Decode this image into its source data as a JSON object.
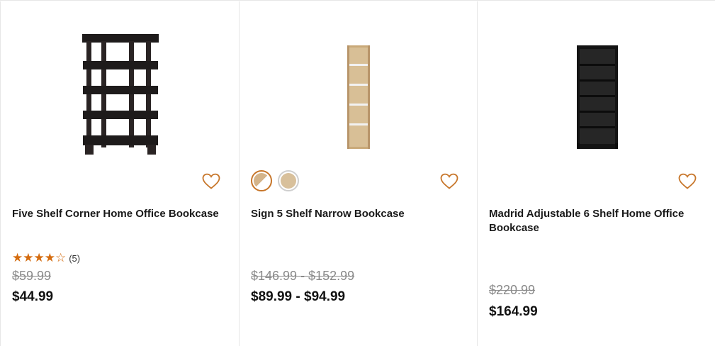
{
  "products": [
    {
      "title": "Five Shelf Corner Home Office Bookcase",
      "rating": {
        "stars": 4,
        "max": 5,
        "count_label": "(5)"
      },
      "was_price": "$59.99",
      "now_price": "$44.99",
      "image_icon": "black-five-tier-shelf",
      "favorite_icon": "heart-outline-icon"
    },
    {
      "title": "Sign 5 Shelf Narrow Bookcase",
      "swatches": [
        {
          "name": "oak-white",
          "selected": true
        },
        {
          "name": "oak",
          "selected": false
        }
      ],
      "was_price": "$146.99 - $152.99",
      "now_price": "$89.99 - $94.99",
      "image_icon": "narrow-oak-bookcase",
      "favorite_icon": "heart-outline-icon"
    },
    {
      "title": "Madrid Adjustable 6 Shelf Home Office Bookcase",
      "was_price": "$220.99",
      "now_price": "$164.99",
      "image_icon": "black-six-shelf-bookcase",
      "favorite_icon": "heart-outline-icon"
    }
  ],
  "colors": {
    "accent": "#d46b0e",
    "heart": "#c7762a",
    "strike_price": "#8a8a8a",
    "divider": "#e6e6e6"
  }
}
